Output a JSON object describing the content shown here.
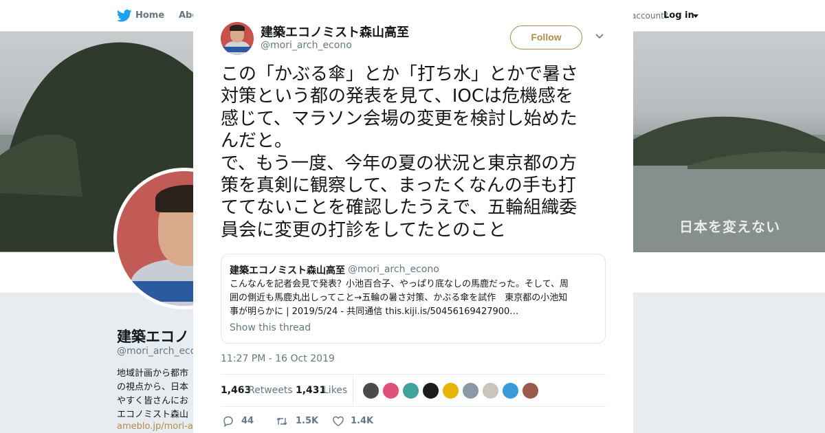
{
  "topbar": {
    "home_label": "Home",
    "about_label": "Abo",
    "account_text": "account?",
    "login_label": "Log in"
  },
  "banner": {
    "slogan": "日本を変えない"
  },
  "profile": {
    "name": "建築エコノ",
    "handle": "@mori_arch_econ",
    "bio_lines": [
      "地域計画から都市",
      "の視点から、日本",
      "やすく皆さんにお",
      "エコノミスト森山"
    ],
    "link": "ameblo.jp/mori-ar"
  },
  "tweet": {
    "author_name": "建築エコノミスト森山高至",
    "author_handle": "@mori_arch_econo",
    "follow_label": "Follow",
    "text_lines": [
      "この「かぶる傘」とか「打ち水」とかで暑さ",
      "対策という都の発表を見て、IOCは危機感を",
      "感じて、マラソン会場の変更を検討し始めた",
      "んだと。",
      "で、もう一度、今年の夏の状況と東京都の方",
      "策を真剣に観察して、まったくなんの手も打",
      "ててないことを確認したうえで、五輪組織委",
      "員会に変更の打診をしてたとのこと"
    ],
    "timestamp": "11:27 PM - 16 Oct 2019",
    "retweets": "1,463",
    "retweets_label": "Retweets",
    "likes": "1,431",
    "likes_label": "Likes",
    "reply_count": "44",
    "retweet_count_short": "1.5K",
    "like_count_short": "1.4K"
  },
  "quoted": {
    "author_name": "建築エコノミスト森山高至",
    "author_handle": "@mori_arch_econo",
    "text_lines": [
      "こんなんを記者会見で発表？小池百合子、やっぱり底なしの馬鹿だった。そして、周",
      "囲の側近も馬鹿丸出しってこと→五輪の暑さ対策、かぶる傘を試作　東京都の小池知",
      "事が明らかに | 2019/5/24 - 共同通信 this.kiji.is/50456169427900…"
    ],
    "show_thread": "Show this thread"
  },
  "likers": [
    {
      "color": "#4a4a4a"
    },
    {
      "color": "#e0507a"
    },
    {
      "color": "#3fa39b"
    },
    {
      "color": "#1c1c1c"
    },
    {
      "color": "#e8b400"
    },
    {
      "color": "#8a98a8"
    },
    {
      "color": "#c9c4bd"
    },
    {
      "color": "#3b9ad9"
    },
    {
      "color": "#9a5a4a"
    }
  ],
  "colors": {
    "accent": "#b5894a",
    "twitter_blue": "#1da1f2",
    "secondary_text": "#657786"
  },
  "icons": [
    "twitter-bird-icon",
    "close-icon",
    "chevron-down-icon",
    "reply-icon",
    "retweet-icon",
    "heart-icon"
  ]
}
